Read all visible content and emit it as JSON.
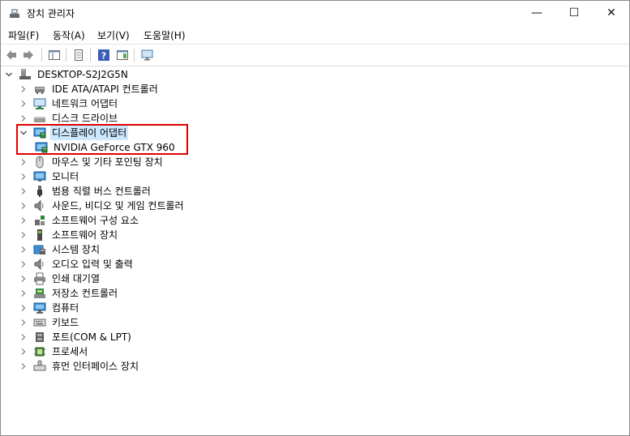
{
  "window": {
    "title": "장치 관리자",
    "controls": {
      "minimize": "—",
      "maximize": "☐",
      "close": "✕"
    }
  },
  "menu": [
    "파일(F)",
    "동작(A)",
    "보기(V)",
    "도움말(H)"
  ],
  "toolbar": {
    "buttons": [
      "back-icon",
      "forward-icon",
      "show-hide-console-tree-icon",
      "properties-icon",
      "help-icon",
      "show-action-pane-icon",
      "scan-hardware-icon"
    ]
  },
  "tree": {
    "root": "DESKTOP-S2J2G5N",
    "items": [
      {
        "label": "IDE ATA/ATAPI 컨트롤러",
        "icon": "ide-controller-icon"
      },
      {
        "label": "네트워크 어댑터",
        "icon": "network-adapter-icon"
      },
      {
        "label": "디스크 드라이브",
        "icon": "disk-drive-icon"
      },
      {
        "label": "디스플레이 어댑터",
        "icon": "display-adapter-icon",
        "expanded": true
      },
      {
        "label": "NVIDIA GeForce GTX 960",
        "icon": "display-adapter-icon",
        "child": true
      },
      {
        "label": "마우스 및 기타 포인팅 장치",
        "icon": "mouse-icon"
      },
      {
        "label": "모니터",
        "icon": "monitor-icon"
      },
      {
        "label": "범용 직렬 버스 컨트롤러",
        "icon": "usb-icon"
      },
      {
        "label": "사운드, 비디오 및 게임 컨트롤러",
        "icon": "speaker-icon"
      },
      {
        "label": "소프트웨어 구성 요소",
        "icon": "software-component-icon"
      },
      {
        "label": "소프트웨어 장치",
        "icon": "software-device-icon"
      },
      {
        "label": "시스템 장치",
        "icon": "system-device-icon"
      },
      {
        "label": "오디오 입력 및 출력",
        "icon": "speaker-icon"
      },
      {
        "label": "인쇄 대기열",
        "icon": "printer-icon"
      },
      {
        "label": "저장소 컨트롤러",
        "icon": "storage-controller-icon"
      },
      {
        "label": "컴퓨터",
        "icon": "computer-icon"
      },
      {
        "label": "키보드",
        "icon": "keyboard-icon"
      },
      {
        "label": "포트(COM & LPT)",
        "icon": "port-icon"
      },
      {
        "label": "프로세서",
        "icon": "processor-icon"
      },
      {
        "label": "휴먼 인터페이스 장치",
        "icon": "hid-icon"
      }
    ]
  },
  "colors": {
    "selection": "#cce8ff",
    "highlight_box": "#e00000"
  }
}
